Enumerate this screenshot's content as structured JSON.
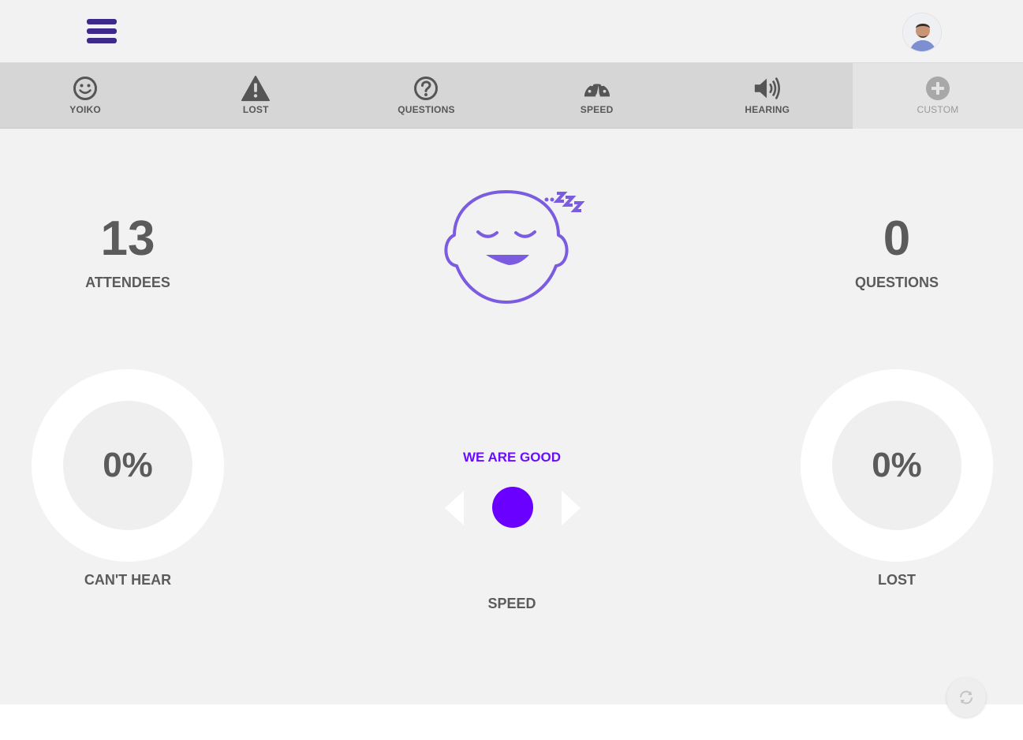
{
  "header": {
    "menu_icon": "hamburger-menu-icon",
    "avatar_alt": "user-avatar"
  },
  "tabs": [
    {
      "label": "YOIKO",
      "icon": "smiley-icon"
    },
    {
      "label": "LOST",
      "icon": "warning-icon"
    },
    {
      "label": "QUESTIONS",
      "icon": "question-icon"
    },
    {
      "label": "SPEED",
      "icon": "speedometer-icon"
    },
    {
      "label": "HEARING",
      "icon": "speaker-icon"
    },
    {
      "label": "CUSTOM",
      "icon": "plus-icon"
    }
  ],
  "stats": {
    "attendees": {
      "value": "13",
      "label": "ATTENDEES"
    },
    "questions": {
      "value": "0",
      "label": "QUESTIONS"
    }
  },
  "face": {
    "icon": "sleeping-face-icon",
    "color": "#7b5ce0"
  },
  "cant_hear": {
    "value": "0%",
    "label": "CAN'T HEAR"
  },
  "lost": {
    "value": "0%",
    "label": "LOST"
  },
  "speed": {
    "status": "WE ARE GOOD",
    "label": "SPEED",
    "accent": "#6a00ff"
  },
  "colors": {
    "brand": "#3d2a8a",
    "accent": "#6a00ff"
  }
}
